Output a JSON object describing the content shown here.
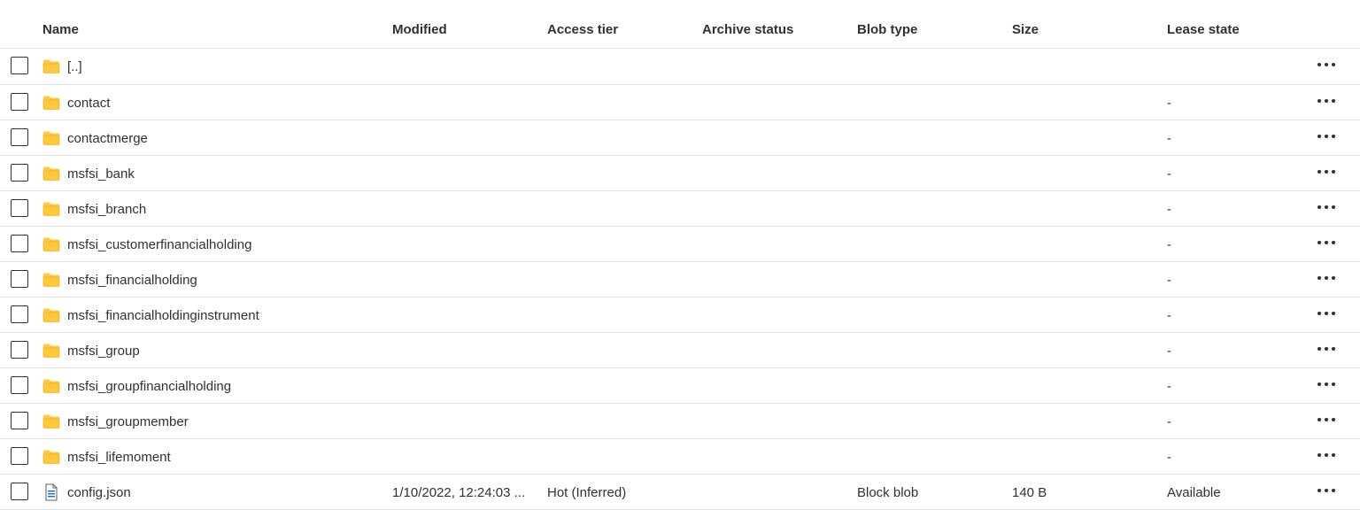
{
  "columns": {
    "name": "Name",
    "modified": "Modified",
    "access_tier": "Access tier",
    "archive_status": "Archive status",
    "blob_type": "Blob type",
    "size": "Size",
    "lease_state": "Lease state"
  },
  "rows": [
    {
      "name": "[..]",
      "icon": "folder-icon",
      "modified": "",
      "access_tier": "",
      "archive_status": "",
      "blob_type": "",
      "size": "",
      "lease_state": ""
    },
    {
      "name": "contact",
      "icon": "folder-icon",
      "modified": "",
      "access_tier": "",
      "archive_status": "",
      "blob_type": "",
      "size": "",
      "lease_state": "-"
    },
    {
      "name": "contactmerge",
      "icon": "folder-icon",
      "modified": "",
      "access_tier": "",
      "archive_status": "",
      "blob_type": "",
      "size": "",
      "lease_state": "-"
    },
    {
      "name": "msfsi_bank",
      "icon": "folder-icon",
      "modified": "",
      "access_tier": "",
      "archive_status": "",
      "blob_type": "",
      "size": "",
      "lease_state": "-"
    },
    {
      "name": "msfsi_branch",
      "icon": "folder-icon",
      "modified": "",
      "access_tier": "",
      "archive_status": "",
      "blob_type": "",
      "size": "",
      "lease_state": "-"
    },
    {
      "name": "msfsi_customerfinancialholding",
      "icon": "folder-icon",
      "modified": "",
      "access_tier": "",
      "archive_status": "",
      "blob_type": "",
      "size": "",
      "lease_state": "-"
    },
    {
      "name": "msfsi_financialholding",
      "icon": "folder-icon",
      "modified": "",
      "access_tier": "",
      "archive_status": "",
      "blob_type": "",
      "size": "",
      "lease_state": "-"
    },
    {
      "name": "msfsi_financialholdinginstrument",
      "icon": "folder-icon",
      "modified": "",
      "access_tier": "",
      "archive_status": "",
      "blob_type": "",
      "size": "",
      "lease_state": "-"
    },
    {
      "name": "msfsi_group",
      "icon": "folder-icon",
      "modified": "",
      "access_tier": "",
      "archive_status": "",
      "blob_type": "",
      "size": "",
      "lease_state": "-"
    },
    {
      "name": "msfsi_groupfinancialholding",
      "icon": "folder-icon",
      "modified": "",
      "access_tier": "",
      "archive_status": "",
      "blob_type": "",
      "size": "",
      "lease_state": "-"
    },
    {
      "name": "msfsi_groupmember",
      "icon": "folder-icon",
      "modified": "",
      "access_tier": "",
      "archive_status": "",
      "blob_type": "",
      "size": "",
      "lease_state": "-"
    },
    {
      "name": "msfsi_lifemoment",
      "icon": "folder-icon",
      "modified": "",
      "access_tier": "",
      "archive_status": "",
      "blob_type": "",
      "size": "",
      "lease_state": "-"
    },
    {
      "name": "config.json",
      "icon": "file-icon",
      "modified": "1/10/2022, 12:24:03 ...",
      "access_tier": "Hot (Inferred)",
      "archive_status": "",
      "blob_type": "Block blob",
      "size": "140 B",
      "lease_state": "Available"
    }
  ],
  "colors": {
    "folder": "#ffc83d",
    "folder_dark": "#e8a500",
    "file_accent": "#0078d4",
    "text": "#323130",
    "divider": "#e1dfdd"
  }
}
